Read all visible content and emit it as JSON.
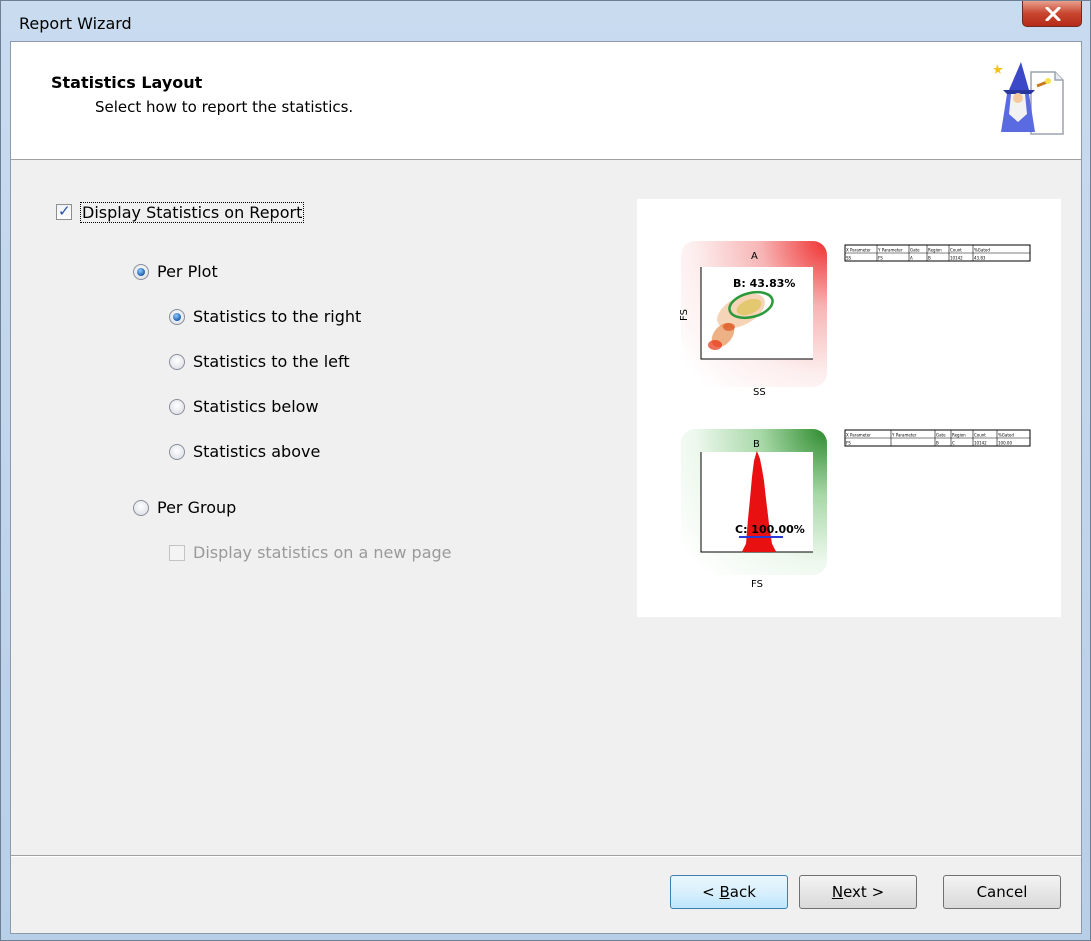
{
  "window": {
    "title": "Report Wizard"
  },
  "header": {
    "title": "Statistics Layout",
    "subtitle": "Select how to report the statistics."
  },
  "options": {
    "display_statistics": {
      "label": "Display Statistics on Report",
      "checked": true
    },
    "per_plot": {
      "label": "Per Plot",
      "selected": true
    },
    "positions": [
      {
        "label": "Statistics to the right",
        "selected": true
      },
      {
        "label": "Statistics to the left",
        "selected": false
      },
      {
        "label": "Statistics below",
        "selected": false
      },
      {
        "label": "Statistics above",
        "selected": false
      }
    ],
    "per_group": {
      "label": "Per Group",
      "selected": false
    },
    "new_page": {
      "label": "Display statistics on a new page",
      "checked": false,
      "enabled": false
    }
  },
  "preview": {
    "plot_a": {
      "title": "A",
      "region_label": "B: 43.83%",
      "x_label": "SS",
      "y_label": "FS"
    },
    "plot_b": {
      "title": "B",
      "region_label": "C: 100.00%",
      "x_label": "FS"
    },
    "table_headers": [
      "X Parameter",
      "Y Parameter",
      "Gate",
      "Region",
      "Count",
      "%Gated"
    ],
    "table_a_row": [
      "SS",
      "FS",
      "A",
      "B",
      "10142",
      "43.83"
    ],
    "table_b_row": [
      "FS",
      "",
      "B",
      "C",
      "10142",
      "100.00"
    ]
  },
  "buttons": {
    "back": {
      "prefix": "< ",
      "mnemonic": "B",
      "rest": "ack"
    },
    "next": {
      "mnemonic": "N",
      "rest": "ext >"
    },
    "cancel": "Cancel"
  },
  "colors": {
    "region_ellipse": "#2a9a3a",
    "histogram": "#e81010",
    "marker": "#2a3ad8",
    "radio_dot": "#1b5fae"
  }
}
